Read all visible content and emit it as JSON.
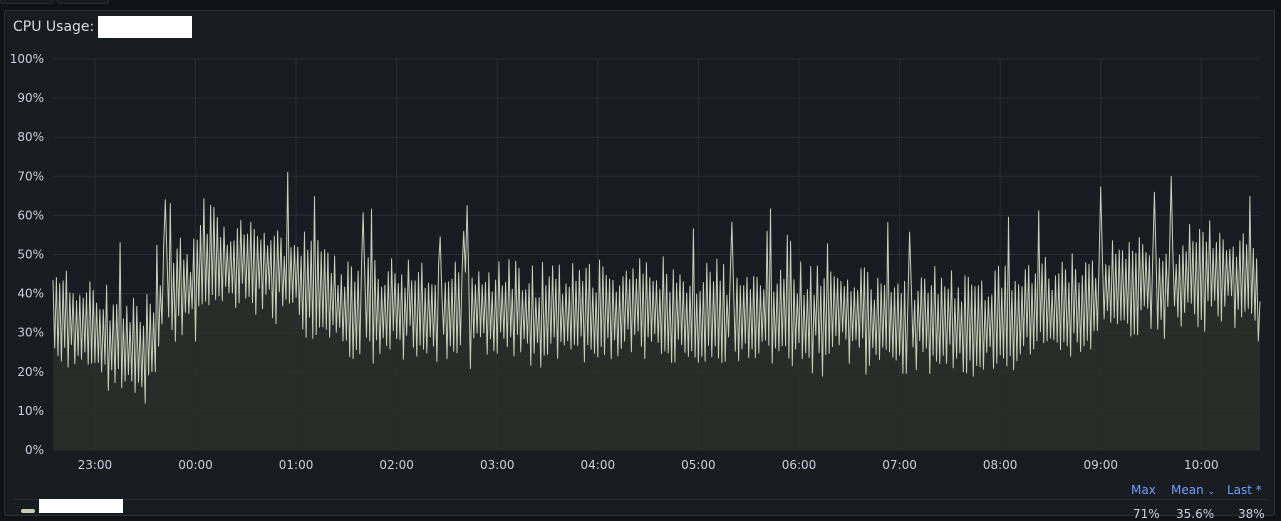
{
  "panel": {
    "title": "CPU Usage:"
  },
  "legend": {
    "headers": {
      "max": "Max",
      "mean": "Mean",
      "mean_indicator": "⌄",
      "last": "Last *"
    },
    "series": [
      {
        "name": "",
        "max": "71%",
        "mean": "35.6%",
        "last": "38%"
      }
    ]
  },
  "chart_data": {
    "type": "area",
    "title": "CPU Usage:",
    "xlabel": "",
    "ylabel": "",
    "ylim": [
      0,
      100
    ],
    "y_ticks": [
      "0%",
      "10%",
      "20%",
      "30%",
      "40%",
      "50%",
      "60%",
      "70%",
      "80%",
      "90%",
      "100%"
    ],
    "x_ticks": [
      "23:00",
      "00:00",
      "01:00",
      "02:00",
      "03:00",
      "04:00",
      "05:00",
      "06:00",
      "07:00",
      "08:00",
      "09:00",
      "10:00"
    ],
    "x_range": [
      "22:35",
      "10:35"
    ],
    "grid": true,
    "legend_position": "bottom",
    "colors": {
      "line": "#c8ccb8",
      "fill": "#2c2f2c",
      "grid": "#2a2c33",
      "axis_text": "#ccccdc"
    },
    "series": [
      {
        "name": "",
        "x": [
          "22:35",
          "22:45",
          "22:55",
          "23:05",
          "23:15",
          "23:25",
          "23:35",
          "23:40",
          "23:50",
          "00:00",
          "00:05",
          "00:15",
          "00:30",
          "00:45",
          "01:00",
          "01:15",
          "01:30",
          "01:45",
          "02:00",
          "02:15",
          "02:30",
          "02:45",
          "03:00",
          "03:15",
          "03:30",
          "03:45",
          "04:00",
          "04:15",
          "04:30",
          "04:45",
          "05:00",
          "05:15",
          "05:30",
          "05:45",
          "06:00",
          "06:15",
          "06:30",
          "06:45",
          "07:00",
          "07:15",
          "07:30",
          "07:45",
          "08:00",
          "08:15",
          "08:30",
          "08:45",
          "09:00",
          "09:15",
          "09:30",
          "09:45",
          "10:00",
          "10:15",
          "10:30",
          "10:35"
        ],
        "values": [
          35,
          33,
          32,
          29,
          26,
          24,
          27,
          38,
          40,
          42,
          50,
          48,
          47,
          46,
          44,
          40,
          36,
          35,
          37,
          36,
          35,
          35,
          36,
          35,
          34,
          34,
          35,
          36,
          36,
          35,
          34,
          35,
          34,
          34,
          33,
          34,
          35,
          33,
          32,
          34,
          33,
          32,
          33,
          35,
          35,
          36,
          40,
          42,
          42,
          43,
          44,
          45,
          44,
          38
        ],
        "max": 71,
        "mean": 35.6,
        "last": 38
      }
    ]
  }
}
